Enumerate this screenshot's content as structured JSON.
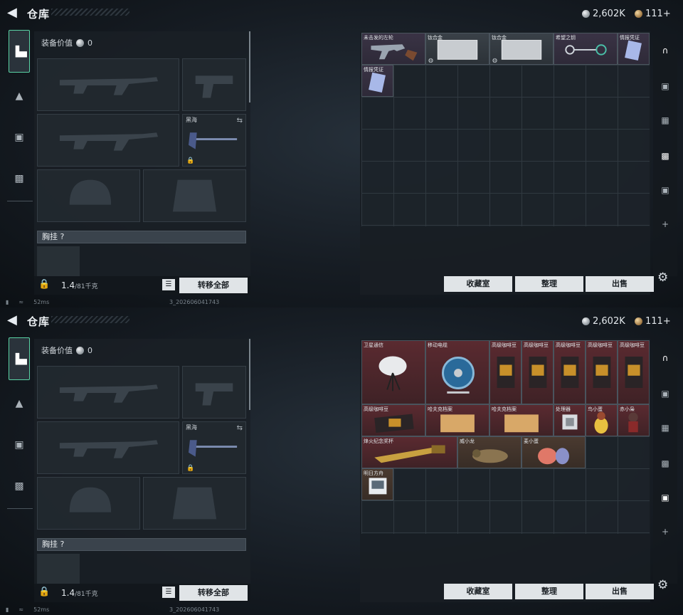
{
  "topbar": {
    "title": "仓库",
    "silver": "2,602K",
    "gold": "111+"
  },
  "loadout": {
    "equip_value_label": "装备价值",
    "equip_value": "0",
    "melee_label": "黑海",
    "chest_label": "胸挂 ?",
    "weight": "1.4",
    "weight_unit": "/81千克",
    "transfer_all": "转移全部"
  },
  "actions": {
    "collection": "收藏室",
    "sort": "整理",
    "sell": "出售"
  },
  "status": {
    "ping": "52ms",
    "uid": "3_202606041743"
  },
  "inventory_1": [
    {
      "name": "未击发的左轮",
      "rarity": "purple",
      "icon": "revolver-icon"
    },
    {
      "name": "钛合金",
      "rarity": "gray",
      "icon": "titanium-plate-icon"
    },
    {
      "name": "钛合金",
      "rarity": "gray",
      "icon": "titanium-plate-icon"
    },
    {
      "name": "希望之钥",
      "rarity": "purple",
      "icon": "key-icon"
    },
    {
      "name": "情报凭证",
      "rarity": "purple",
      "icon": "intel-card-icon"
    },
    {
      "name": "情报凭证",
      "rarity": "purple",
      "icon": "intel-card-icon"
    }
  ],
  "inventory_2": [
    {
      "name": "卫星通信",
      "rarity": "red",
      "icon": "satellite-dish-icon"
    },
    {
      "name": "移动电缆",
      "rarity": "red",
      "icon": "cable-reel-icon"
    },
    {
      "name": "高级咖啡豆",
      "rarity": "red",
      "icon": "coffee-bag-icon"
    },
    {
      "name": "高级咖啡豆",
      "rarity": "red",
      "icon": "coffee-bag-icon"
    },
    {
      "name": "高级咖啡豆",
      "rarity": "red",
      "icon": "coffee-bag-icon"
    },
    {
      "name": "高级咖啡豆",
      "rarity": "red",
      "icon": "coffee-bag-icon"
    },
    {
      "name": "高级咖啡豆",
      "rarity": "red",
      "icon": "coffee-bag-icon"
    },
    {
      "name": "高级咖啡豆",
      "rarity": "red",
      "icon": "coffee-bag-icon"
    },
    {
      "name": "哈夫克档案",
      "rarity": "red",
      "icon": "dossier-icon"
    },
    {
      "name": "哈夫克档案",
      "rarity": "red",
      "icon": "dossier-icon"
    },
    {
      "name": "处理器",
      "rarity": "red",
      "icon": "processor-icon"
    },
    {
      "name": "鸟小蛋",
      "rarity": "red",
      "icon": "egg-figure-icon"
    },
    {
      "name": "赤小枭",
      "rarity": "red",
      "icon": "hooded-figure-icon"
    },
    {
      "name": "烽火纪念奖杯",
      "rarity": "red",
      "icon": "trophy-icon"
    },
    {
      "name": "威小龙",
      "rarity": "brown",
      "icon": "dragon-figure-icon"
    },
    {
      "name": "麦小蛋",
      "rarity": "brown",
      "icon": "rabbit-egg-icon"
    },
    {
      "name": "明日方舟",
      "rarity": "brown",
      "icon": "game-box-icon"
    }
  ]
}
